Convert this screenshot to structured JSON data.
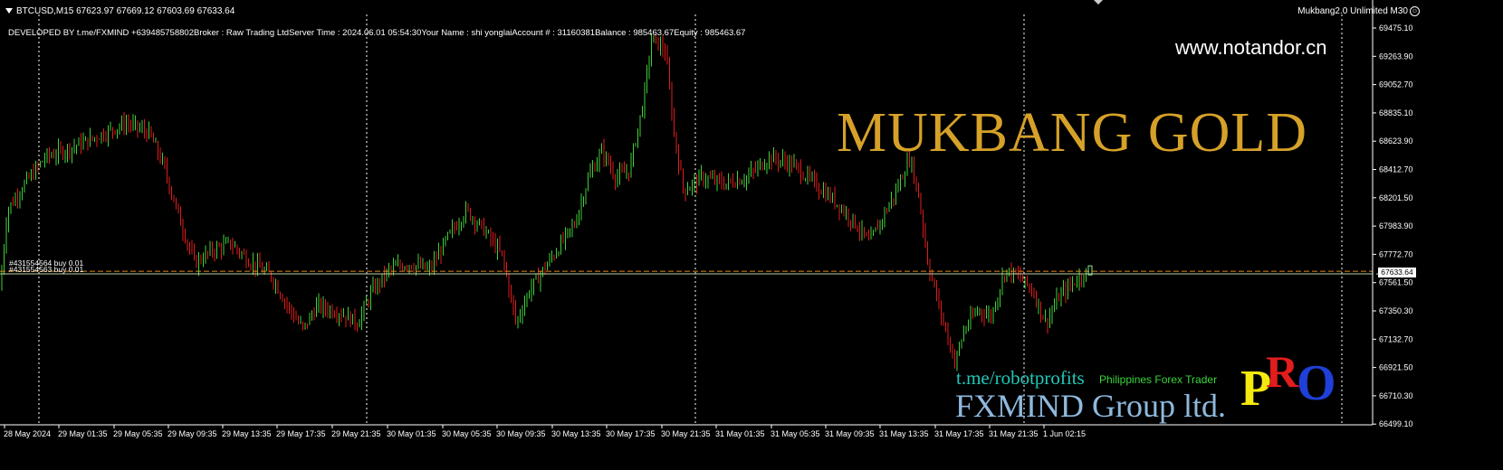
{
  "header": {
    "symbol_line": "BTCUSD,M15  67623.97 67669.12 67603.69 67633.64",
    "ea_label": "Mukbang2.0 Unlimited M30",
    "smile_glyph": "☺"
  },
  "info_bar": {
    "developer": "DEVELOPED BY t.me/FXMIND  +639485758802",
    "broker": "Broker  : Raw Trading Ltd",
    "server_time": "Server Time : 2024.06.01 05:54:30",
    "your_name": "Your Name    : shi yonglai",
    "account": "Account #  : 31160381",
    "balance": "Balance : 985463.67",
    "equity": "Equity    : 985463.67"
  },
  "overlay": {
    "website": "www.notandor.cn",
    "brand": "MUKBANG GOLD",
    "telegram": "t.me/robotprofits",
    "tagline": "Philippines Forex Trader",
    "company": "FXMIND Group ltd.",
    "pro_p": "P",
    "pro_r": "R",
    "pro_o": "O"
  },
  "orders": [
    {
      "label": "#431554564 buy 0.01"
    },
    {
      "label": "#431554563 buy 0.01"
    }
  ],
  "price_tag": "67633.64",
  "colors": {
    "background": "#000000",
    "bull": "#3fd13a",
    "bear": "#e01b1b",
    "grid": "#ffffff",
    "bid_line": "#b6d4a0",
    "order_line": "#e08a1a",
    "brand": "#d6a128"
  },
  "chart_data": {
    "type": "candlestick",
    "symbol": "BTCUSD",
    "timeframe": "M15",
    "ohlc_last": {
      "open": 67623.97,
      "high": 67669.12,
      "low": 67603.69,
      "close": 67633.64
    },
    "ylim": [
      66480,
      69580
    ],
    "y_ticks": [
      "69475.10",
      "69263.90",
      "69052.70",
      "68835.10",
      "68623.90",
      "68412.70",
      "68201.50",
      "67983.90",
      "67772.70",
      "67561.50",
      "67350.30",
      "67132.70",
      "66921.50",
      "66710.30",
      "66499.10"
    ],
    "x_ticks": [
      "28 May 2024",
      "29 May 01:35",
      "29 May 05:35",
      "29 May 09:35",
      "29 May 13:35",
      "29 May 17:35",
      "29 May 21:35",
      "30 May 01:35",
      "30 May 05:35",
      "30 May 09:35",
      "30 May 13:35",
      "30 May 17:35",
      "30 May 21:35",
      "31 May 01:35",
      "31 May 05:35",
      "31 May 09:35",
      "31 May 13:35",
      "31 May 17:35",
      "31 May 21:35",
      "1 Jun 02:15"
    ],
    "price_path": [
      [
        0,
        67500
      ],
      [
        8,
        68100
      ],
      [
        25,
        68280
      ],
      [
        50,
        68500
      ],
      [
        70,
        68550
      ],
      [
        95,
        68620
      ],
      [
        120,
        68700
      ],
      [
        140,
        68760
      ],
      [
        165,
        68680
      ],
      [
        180,
        68450
      ],
      [
        200,
        68000
      ],
      [
        215,
        67700
      ],
      [
        235,
        67800
      ],
      [
        255,
        67850
      ],
      [
        275,
        67720
      ],
      [
        300,
        67600
      ],
      [
        320,
        67350
      ],
      [
        335,
        67200
      ],
      [
        350,
        67380
      ],
      [
        375,
        67330
      ],
      [
        395,
        67250
      ],
      [
        410,
        67480
      ],
      [
        430,
        67650
      ],
      [
        450,
        67700
      ],
      [
        475,
        67650
      ],
      [
        495,
        67900
      ],
      [
        515,
        68100
      ],
      [
        535,
        67950
      ],
      [
        555,
        67750
      ],
      [
        570,
        67250
      ],
      [
        585,
        67500
      ],
      [
        600,
        67650
      ],
      [
        615,
        67800
      ],
      [
        635,
        68000
      ],
      [
        650,
        68350
      ],
      [
        665,
        68550
      ],
      [
        680,
        68350
      ],
      [
        695,
        68400
      ],
      [
        710,
        68900
      ],
      [
        720,
        69400
      ],
      [
        735,
        69300
      ],
      [
        745,
        68650
      ],
      [
        755,
        68250
      ],
      [
        775,
        68350
      ],
      [
        800,
        68300
      ],
      [
        825,
        68350
      ],
      [
        850,
        68500
      ],
      [
        875,
        68450
      ],
      [
        900,
        68300
      ],
      [
        925,
        68150
      ],
      [
        945,
        68000
      ],
      [
        960,
        67850
      ],
      [
        975,
        68050
      ],
      [
        990,
        68250
      ],
      [
        1005,
        68500
      ],
      [
        1015,
        68200
      ],
      [
        1025,
        67700
      ],
      [
        1040,
        67300
      ],
      [
        1055,
        66950
      ],
      [
        1065,
        67200
      ],
      [
        1080,
        67350
      ],
      [
        1095,
        67300
      ],
      [
        1110,
        67650
      ],
      [
        1125,
        67600
      ],
      [
        1140,
        67500
      ],
      [
        1155,
        67250
      ],
      [
        1170,
        67450
      ],
      [
        1185,
        67550
      ],
      [
        1200,
        67640
      ]
    ],
    "order_price": 67640,
    "bid_price": 67620,
    "grid": "vertical dotted"
  }
}
